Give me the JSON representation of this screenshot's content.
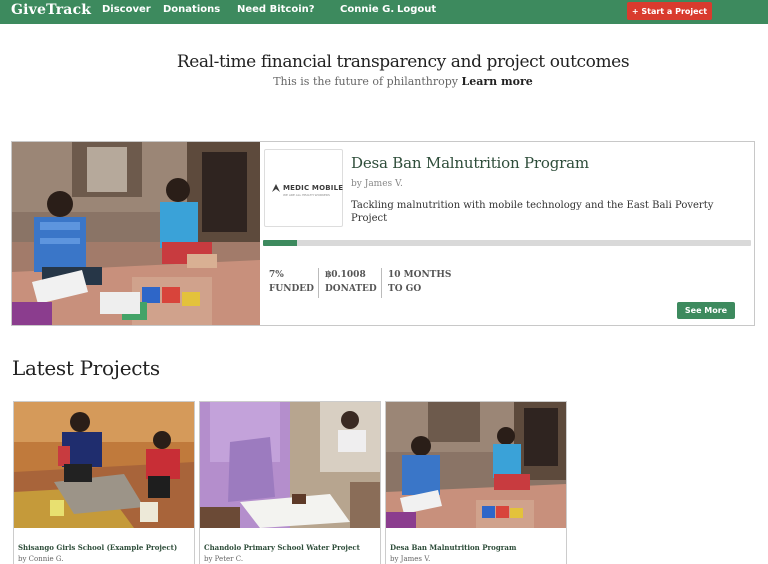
{
  "nav": {
    "brand": "GiveTrack",
    "links": [
      "Discover",
      "Donations",
      "Need Bitcoin?",
      "Connie G.",
      "Logout"
    ],
    "start_button": "+ Start a Project"
  },
  "hero": {
    "title": "Real-time financial transparency and project outcomes",
    "subtitle": "This is the future of philanthropy",
    "learn_more": "Learn more"
  },
  "featured": {
    "logo_text": "MEDIC MOBILE",
    "logo_subtext": "WE ARE ALL HEALTH WORKERS",
    "title": "Desa Ban Malnutrition Program",
    "author": "by James V.",
    "description": "Tackling malnutrition with mobile technology and the East Bali Poverty Project",
    "progress_fraction": 0.07,
    "stats": [
      {
        "value": "7%",
        "label": "FUNDED"
      },
      {
        "value": "฿0.1008",
        "label": "DONATED"
      },
      {
        "value": "10 MONTHS",
        "label": "TO GO"
      }
    ],
    "see_more": "See More"
  },
  "latest": {
    "heading": "Latest Projects",
    "cards": [
      {
        "title": "Shisango Girls School (Example Project)",
        "author": "by Connie G."
      },
      {
        "title": "Chandolo Primary School Water Project",
        "author": "by Peter C."
      },
      {
        "title": "Desa Ban Malnutrition Program",
        "author": "by James V."
      }
    ]
  },
  "colors": {
    "brand_green": "#3d8a5e",
    "start_red": "#d93b2e",
    "title_green": "#2e4d3a"
  }
}
